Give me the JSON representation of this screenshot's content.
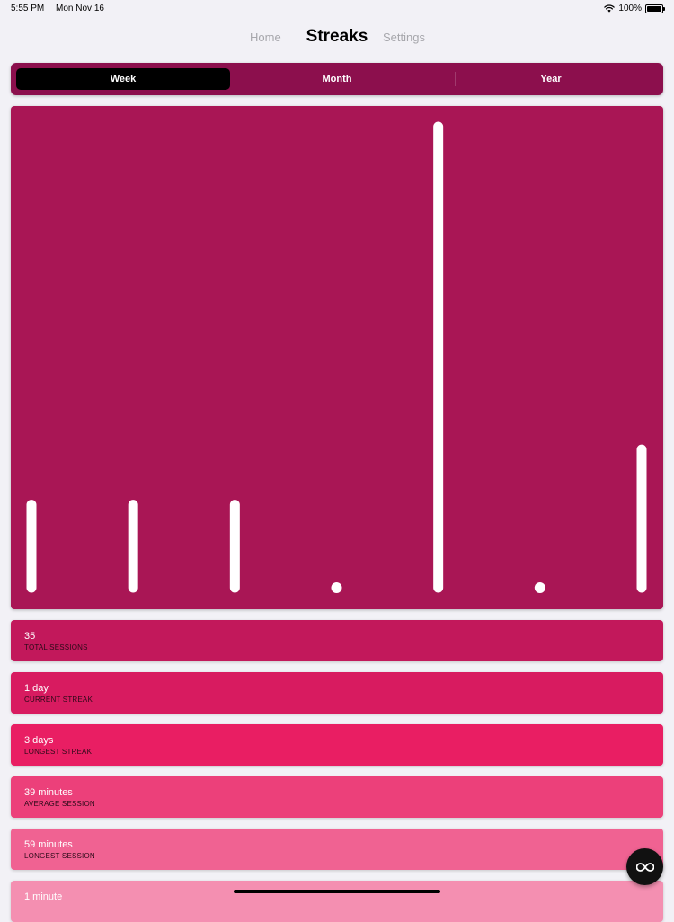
{
  "status_bar": {
    "time": "5:55 PM",
    "date": "Mon Nov 16",
    "battery": "100%",
    "battery_level": 1.0
  },
  "nav": {
    "left": "Home",
    "title": "Streaks",
    "right": "Settings"
  },
  "segments": [
    {
      "label": "Week",
      "selected": true
    },
    {
      "label": "Month",
      "selected": false
    },
    {
      "label": "Year",
      "selected": false
    }
  ],
  "chart_data": {
    "type": "bar",
    "values": [
      0.18,
      0.18,
      0.18,
      0,
      1.0,
      0,
      0.3
    ],
    "colors": {
      "background": "#a91655",
      "bar": "#ffffff"
    }
  },
  "stats": [
    {
      "value": "35",
      "label": "TOTAL SESSIONS",
      "color": "#c2185b"
    },
    {
      "value": "1 day",
      "label": "CURRENT STREAK",
      "color": "#d81b60"
    },
    {
      "value": "3 days",
      "label": "LONGEST STREAK",
      "color": "#e91e63"
    },
    {
      "value": "39 minutes",
      "label": "AVERAGE SESSION",
      "color": "#ec407a"
    },
    {
      "value": "59 minutes",
      "label": "LONGEST SESSION",
      "color": "#f06292"
    },
    {
      "value": "1 minute",
      "label": "",
      "color": "#f48fb1"
    }
  ],
  "fab": {
    "icon": "infinity-icon"
  }
}
